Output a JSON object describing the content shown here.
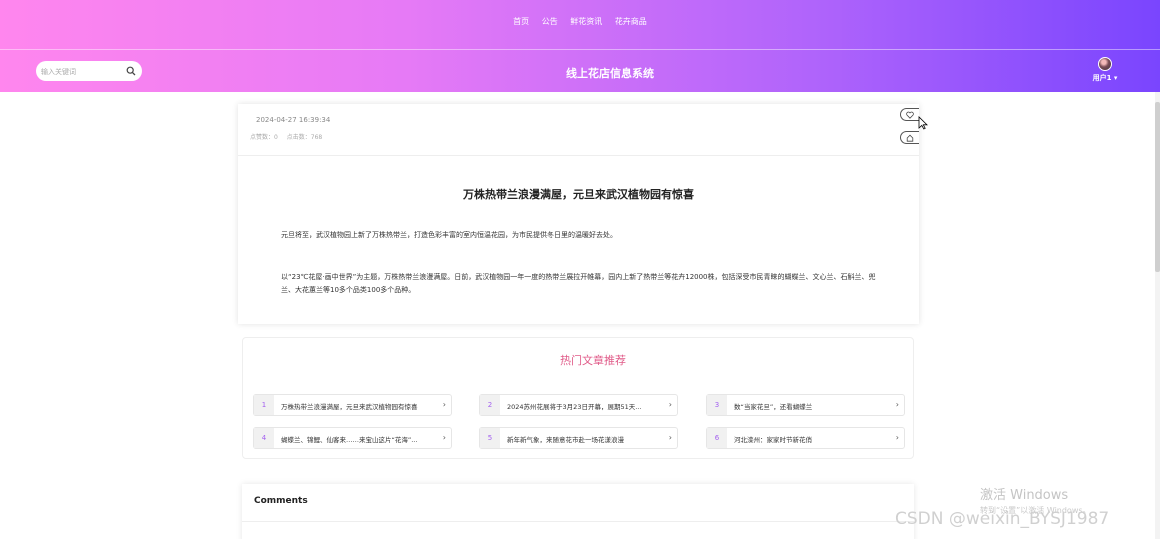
{
  "nav": {
    "items": [
      "首页",
      "公告",
      "鲜花资讯",
      "花卉商品"
    ]
  },
  "header": {
    "title": "线上花店信息系统",
    "search_placeholder": "输入关键词",
    "username": "用户1"
  },
  "article": {
    "date": "2024-04-27 16:39:34",
    "likes_label": "点赞数：0",
    "views_label": "点击数：768",
    "title": "万株热带兰浪漫满屋，元旦来武汉植物园有惊喜",
    "paragraphs": [
      "元旦将至，武汉植物园上新了万株热带兰，打造色彩丰富的室内恒温花园，为市民提供冬日里的温暖好去处。",
      "以“23℃花屋·画中世界”为主题，万株热带兰浪漫满屋。日前，武汉植物园一年一度的热带兰展拉开帷幕，园内上新了热带兰等花卉12000株，包括深受市民青睐的蝴蝶兰、文心兰、石斛兰、兜兰、大花蕙兰等10多个品类100多个品种。"
    ]
  },
  "hot": {
    "title": "热门文章推荐",
    "items": [
      {
        "num": "1",
        "text": "万株热带兰浪漫满屋，元旦来武汉植物园有惊喜"
      },
      {
        "num": "2",
        "text": "2024苏州花展将于3月23日开幕，展期51天..."
      },
      {
        "num": "3",
        "text": "数“当家花旦”，还看蝴蝶兰"
      },
      {
        "num": "4",
        "text": "蝴蝶兰、锦鲤、仙客来……来宝山这片“花海”..."
      },
      {
        "num": "5",
        "text": "新年新气象，来随意花市赴一场花漾浪漫"
      },
      {
        "num": "6",
        "text": "河北滦州：家家时节新花俏"
      }
    ]
  },
  "comments": {
    "title": "Comments"
  },
  "watermarks": {
    "windows_line1": "激活 Windows",
    "windows_line2": "转到“设置”以激活 Windows。",
    "csdn": "CSDN @weixin_BYSJ1987"
  },
  "colors": {
    "header_start": "#ff86ee",
    "header_end": "#7a45fe",
    "hot_title": "#e05a88",
    "hot_num": "#a35ff0"
  }
}
